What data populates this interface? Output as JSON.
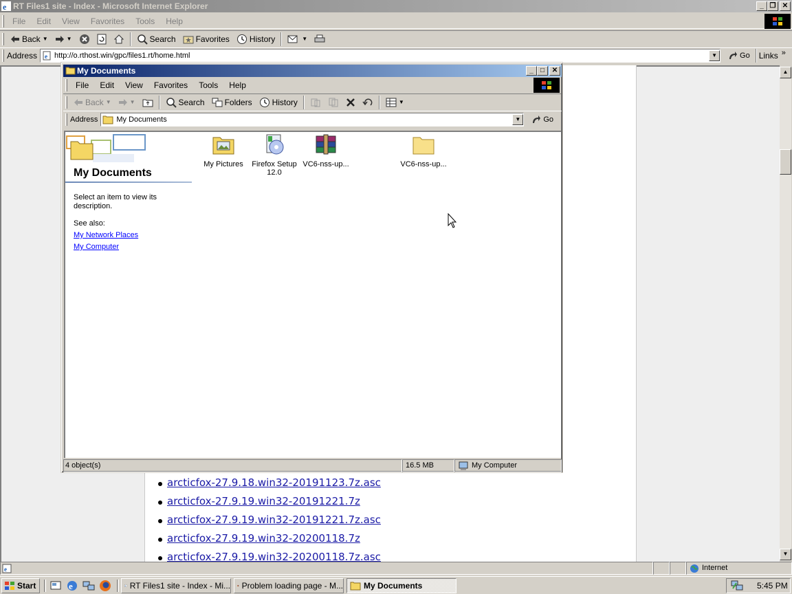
{
  "ie": {
    "title": "RT Files1 site - Index - Microsoft Internet Explorer",
    "menu": [
      "File",
      "Edit",
      "View",
      "Favorites",
      "Tools",
      "Help"
    ],
    "toolbar": {
      "back": "Back",
      "search": "Search",
      "favorites": "Favorites",
      "history": "History"
    },
    "address_label": "Address",
    "address_value": "http://o.rthost.win/gpc/files1.rt/home.html",
    "go": "Go",
    "links": "Links",
    "links_more": "»",
    "page_links": [
      "arcticfox-27.9.18.win32-20191123.7z.asc",
      "arcticfox-27.9.19.win32-20191221.7z",
      "arcticfox-27.9.19.win32-20191221.7z.asc",
      "arcticfox-27.9.19.win32-20200118.7z",
      "arcticfox-27.9.19.win32-20200118.7z.asc"
    ],
    "status_zone": "Internet"
  },
  "explorer": {
    "title": "My Documents",
    "menu": [
      "File",
      "Edit",
      "View",
      "Favorites",
      "Tools",
      "Help"
    ],
    "toolbar": {
      "back": "Back",
      "search": "Search",
      "folders": "Folders",
      "history": "History"
    },
    "address_label": "Address",
    "address_value": "My Documents",
    "go": "Go",
    "sidebar": {
      "title": "My Documents",
      "description": "Select an item to view its description.",
      "see_also": "See also:",
      "links": [
        "My Network Places",
        "My Computer"
      ]
    },
    "items": [
      {
        "label": "My Pictures",
        "icon": "pictures-folder-icon"
      },
      {
        "label": "Firefox Setup 12.0",
        "icon": "installer-icon"
      },
      {
        "label": "VC6-nss-up...",
        "icon": "winrar-archive-icon"
      },
      {
        "label": "VC6-nss-up...",
        "icon": "folder-icon"
      }
    ],
    "status": {
      "objects": "4 object(s)",
      "size": "16.5 MB",
      "zone": "My Computer"
    }
  },
  "taskbar": {
    "start": "Start",
    "tasks": [
      {
        "label": "RT Files1 site - Index - Mi...",
        "active": false
      },
      {
        "label": "Problem loading page - M...",
        "active": false
      },
      {
        "label": "My Documents",
        "active": true
      }
    ],
    "clock": "5:45 PM"
  }
}
